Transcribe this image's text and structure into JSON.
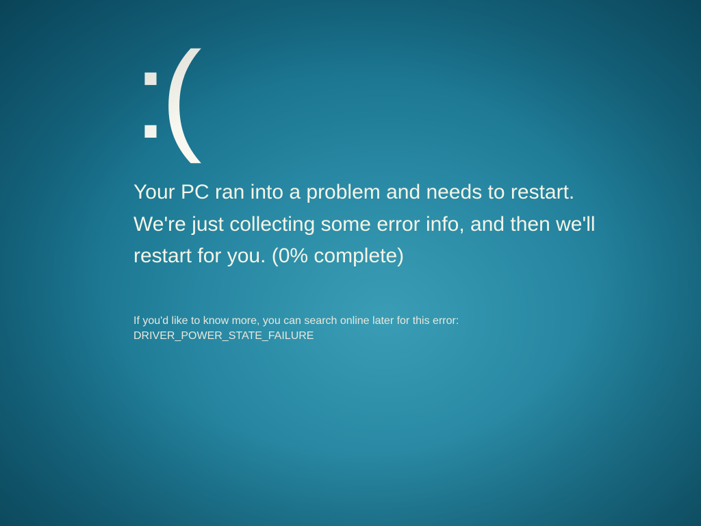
{
  "bsod": {
    "face": ":(",
    "message": "Your PC ran into a problem and needs to restart. We're just collecting some error info, and then we'll restart for you. (0% complete)",
    "hint": "If you'd like to know more, you can search online later for this error: DRIVER_POWER_STATE_FAILURE",
    "percent_complete": 0,
    "error_code": "DRIVER_POWER_STATE_FAILURE"
  }
}
